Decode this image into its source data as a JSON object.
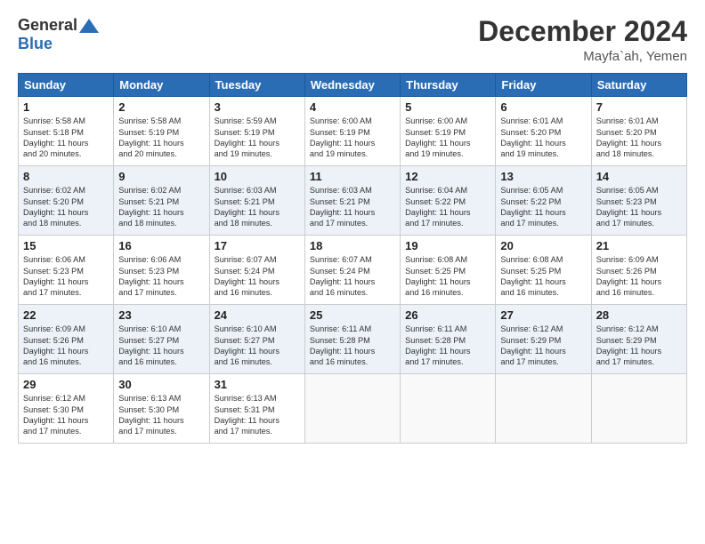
{
  "header": {
    "logo_line1": "General",
    "logo_line2": "Blue",
    "month_title": "December 2024",
    "location": "Mayfa`ah, Yemen"
  },
  "days_of_week": [
    "Sunday",
    "Monday",
    "Tuesday",
    "Wednesday",
    "Thursday",
    "Friday",
    "Saturday"
  ],
  "weeks": [
    [
      {
        "day": "1",
        "lines": [
          "Sunrise: 5:58 AM",
          "Sunset: 5:18 PM",
          "Daylight: 11 hours",
          "and 20 minutes."
        ]
      },
      {
        "day": "2",
        "lines": [
          "Sunrise: 5:58 AM",
          "Sunset: 5:19 PM",
          "Daylight: 11 hours",
          "and 20 minutes."
        ]
      },
      {
        "day": "3",
        "lines": [
          "Sunrise: 5:59 AM",
          "Sunset: 5:19 PM",
          "Daylight: 11 hours",
          "and 19 minutes."
        ]
      },
      {
        "day": "4",
        "lines": [
          "Sunrise: 6:00 AM",
          "Sunset: 5:19 PM",
          "Daylight: 11 hours",
          "and 19 minutes."
        ]
      },
      {
        "day": "5",
        "lines": [
          "Sunrise: 6:00 AM",
          "Sunset: 5:19 PM",
          "Daylight: 11 hours",
          "and 19 minutes."
        ]
      },
      {
        "day": "6",
        "lines": [
          "Sunrise: 6:01 AM",
          "Sunset: 5:20 PM",
          "Daylight: 11 hours",
          "and 19 minutes."
        ]
      },
      {
        "day": "7",
        "lines": [
          "Sunrise: 6:01 AM",
          "Sunset: 5:20 PM",
          "Daylight: 11 hours",
          "and 18 minutes."
        ]
      }
    ],
    [
      {
        "day": "8",
        "lines": [
          "Sunrise: 6:02 AM",
          "Sunset: 5:20 PM",
          "Daylight: 11 hours",
          "and 18 minutes."
        ]
      },
      {
        "day": "9",
        "lines": [
          "Sunrise: 6:02 AM",
          "Sunset: 5:21 PM",
          "Daylight: 11 hours",
          "and 18 minutes."
        ]
      },
      {
        "day": "10",
        "lines": [
          "Sunrise: 6:03 AM",
          "Sunset: 5:21 PM",
          "Daylight: 11 hours",
          "and 18 minutes."
        ]
      },
      {
        "day": "11",
        "lines": [
          "Sunrise: 6:03 AM",
          "Sunset: 5:21 PM",
          "Daylight: 11 hours",
          "and 17 minutes."
        ]
      },
      {
        "day": "12",
        "lines": [
          "Sunrise: 6:04 AM",
          "Sunset: 5:22 PM",
          "Daylight: 11 hours",
          "and 17 minutes."
        ]
      },
      {
        "day": "13",
        "lines": [
          "Sunrise: 6:05 AM",
          "Sunset: 5:22 PM",
          "Daylight: 11 hours",
          "and 17 minutes."
        ]
      },
      {
        "day": "14",
        "lines": [
          "Sunrise: 6:05 AM",
          "Sunset: 5:23 PM",
          "Daylight: 11 hours",
          "and 17 minutes."
        ]
      }
    ],
    [
      {
        "day": "15",
        "lines": [
          "Sunrise: 6:06 AM",
          "Sunset: 5:23 PM",
          "Daylight: 11 hours",
          "and 17 minutes."
        ]
      },
      {
        "day": "16",
        "lines": [
          "Sunrise: 6:06 AM",
          "Sunset: 5:23 PM",
          "Daylight: 11 hours",
          "and 17 minutes."
        ]
      },
      {
        "day": "17",
        "lines": [
          "Sunrise: 6:07 AM",
          "Sunset: 5:24 PM",
          "Daylight: 11 hours",
          "and 16 minutes."
        ]
      },
      {
        "day": "18",
        "lines": [
          "Sunrise: 6:07 AM",
          "Sunset: 5:24 PM",
          "Daylight: 11 hours",
          "and 16 minutes."
        ]
      },
      {
        "day": "19",
        "lines": [
          "Sunrise: 6:08 AM",
          "Sunset: 5:25 PM",
          "Daylight: 11 hours",
          "and 16 minutes."
        ]
      },
      {
        "day": "20",
        "lines": [
          "Sunrise: 6:08 AM",
          "Sunset: 5:25 PM",
          "Daylight: 11 hours",
          "and 16 minutes."
        ]
      },
      {
        "day": "21",
        "lines": [
          "Sunrise: 6:09 AM",
          "Sunset: 5:26 PM",
          "Daylight: 11 hours",
          "and 16 minutes."
        ]
      }
    ],
    [
      {
        "day": "22",
        "lines": [
          "Sunrise: 6:09 AM",
          "Sunset: 5:26 PM",
          "Daylight: 11 hours",
          "and 16 minutes."
        ]
      },
      {
        "day": "23",
        "lines": [
          "Sunrise: 6:10 AM",
          "Sunset: 5:27 PM",
          "Daylight: 11 hours",
          "and 16 minutes."
        ]
      },
      {
        "day": "24",
        "lines": [
          "Sunrise: 6:10 AM",
          "Sunset: 5:27 PM",
          "Daylight: 11 hours",
          "and 16 minutes."
        ]
      },
      {
        "day": "25",
        "lines": [
          "Sunrise: 6:11 AM",
          "Sunset: 5:28 PM",
          "Daylight: 11 hours",
          "and 16 minutes."
        ]
      },
      {
        "day": "26",
        "lines": [
          "Sunrise: 6:11 AM",
          "Sunset: 5:28 PM",
          "Daylight: 11 hours",
          "and 17 minutes."
        ]
      },
      {
        "day": "27",
        "lines": [
          "Sunrise: 6:12 AM",
          "Sunset: 5:29 PM",
          "Daylight: 11 hours",
          "and 17 minutes."
        ]
      },
      {
        "day": "28",
        "lines": [
          "Sunrise: 6:12 AM",
          "Sunset: 5:29 PM",
          "Daylight: 11 hours",
          "and 17 minutes."
        ]
      }
    ],
    [
      {
        "day": "29",
        "lines": [
          "Sunrise: 6:12 AM",
          "Sunset: 5:30 PM",
          "Daylight: 11 hours",
          "and 17 minutes."
        ]
      },
      {
        "day": "30",
        "lines": [
          "Sunrise: 6:13 AM",
          "Sunset: 5:30 PM",
          "Daylight: 11 hours",
          "and 17 minutes."
        ]
      },
      {
        "day": "31",
        "lines": [
          "Sunrise: 6:13 AM",
          "Sunset: 5:31 PM",
          "Daylight: 11 hours",
          "and 17 minutes."
        ]
      },
      {
        "day": "",
        "lines": []
      },
      {
        "day": "",
        "lines": []
      },
      {
        "day": "",
        "lines": []
      },
      {
        "day": "",
        "lines": []
      }
    ]
  ]
}
